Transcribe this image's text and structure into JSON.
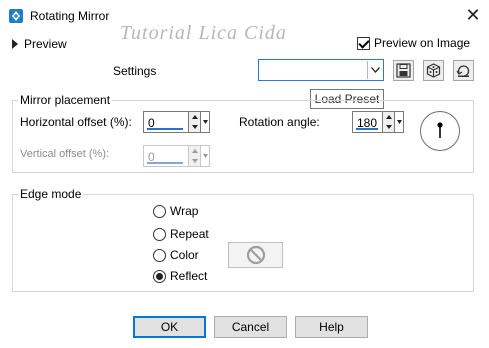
{
  "window": {
    "title": "Rotating Mirror",
    "close_glyph": "✕"
  },
  "watermark": "Tutorial Lica Cida",
  "preview": {
    "label": "Preview",
    "preview_on_image_label": "Preview on Image",
    "preview_on_image_checked": true
  },
  "settings": {
    "label": "Settings",
    "preset_value": "",
    "tooltip": "Load Preset"
  },
  "toolbar_icons": [
    "save-preset-icon",
    "randomize-icon",
    "reset-icon"
  ],
  "mirror_placement": {
    "title": "Mirror placement",
    "horizontal_offset": {
      "label": "Horizontal offset (%):",
      "value": "0"
    },
    "vertical_offset": {
      "label": "Vertical offset (%):",
      "value": "0",
      "disabled": true
    },
    "rotation_angle": {
      "label": "Rotation angle:",
      "value": "180"
    }
  },
  "edge_mode": {
    "title": "Edge mode",
    "options": [
      "Wrap",
      "Repeat",
      "Color",
      "Reflect"
    ],
    "selected": "Reflect"
  },
  "buttons": {
    "ok": "OK",
    "cancel": "Cancel",
    "help": "Help"
  },
  "colors": {
    "accent": "#0078d7",
    "field_underline": "#2a6fd0",
    "app_icon": "#1e7fc7"
  }
}
